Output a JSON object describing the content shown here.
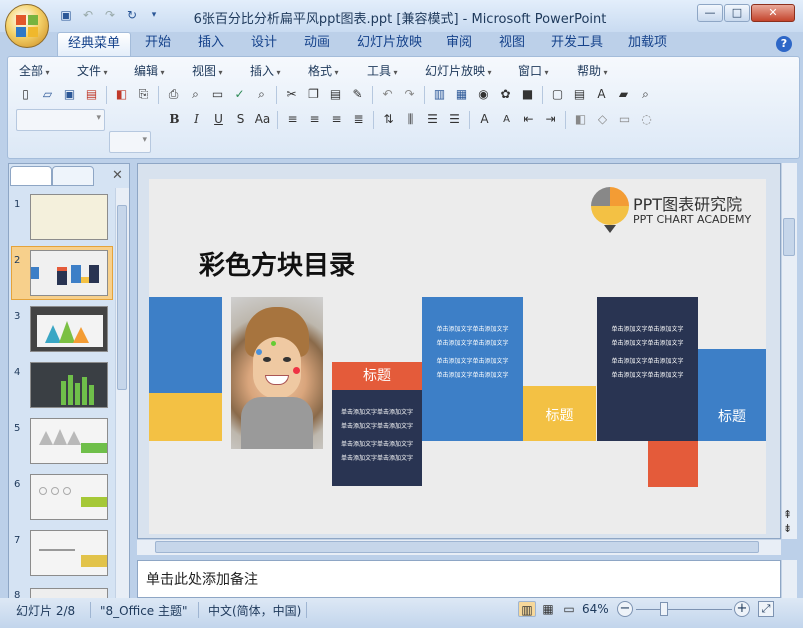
{
  "window": {
    "title": "6张百分比分析扁平风ppt图表.ppt [兼容模式] - Microsoft PowerPoint",
    "minimize": "—",
    "maximize": "□",
    "close": "✕"
  },
  "quick_access": [
    "save-icon",
    "undo-icon",
    "redo-icon",
    "refresh-icon",
    "customize-icon"
  ],
  "tabs": [
    {
      "label": "经典菜单"
    },
    {
      "label": "开始"
    },
    {
      "label": "插入"
    },
    {
      "label": "设计"
    },
    {
      "label": "动画"
    },
    {
      "label": "幻灯片放映"
    },
    {
      "label": "审阅"
    },
    {
      "label": "视图"
    },
    {
      "label": "开发工具"
    },
    {
      "label": "加载项"
    }
  ],
  "menu": [
    "全部",
    "文件",
    "编辑",
    "视图",
    "插入",
    "格式",
    "工具",
    "幻灯片放映",
    "窗口",
    "帮助"
  ],
  "toolbar_font": {
    "bold": "B",
    "italic": "I",
    "underline": "U",
    "shadow": "S",
    "abc": "Aa"
  },
  "slides_panel": {
    "numbers": [
      "1",
      "2",
      "3",
      "4",
      "5",
      "6",
      "7",
      "8"
    ],
    "selected": "2"
  },
  "slide": {
    "title": "彩色方块目录",
    "brand_cn": "PPT图表研究院",
    "brand_en": "PPT CHART ACADEMY",
    "label_1": "标题",
    "label_2": "标题",
    "label_3": "标题",
    "text_lines_1": [
      "单击添加文字单击添加文字",
      "单击添加文字单击添加文字",
      "单击添加文字单击添加文字",
      "单击添加文字单击添加文字"
    ],
    "text_lines_2": [
      "单击添加文字单击添加文字",
      "单击添加文字单击添加文字",
      "单击添加文字单击添加文字",
      "单击添加文字单击添加文字"
    ],
    "text_lines_3": [
      "单击添加文字单击添加文字",
      "单击添加文字单击添加文字",
      "单击添加文字单击添加文字",
      "单击添加文字单击添加文字"
    ]
  },
  "notes": {
    "placeholder": "单击此处添加备注"
  },
  "status": {
    "slide": "幻灯片 2/8",
    "theme": "\"8_Office 主题\"",
    "language": "中文(简体，中国)",
    "zoom": "64%"
  },
  "colors": {
    "blue": "#3d7fc7",
    "yellow": "#f3c144",
    "navy": "#293452",
    "red": "#e45b3a"
  }
}
